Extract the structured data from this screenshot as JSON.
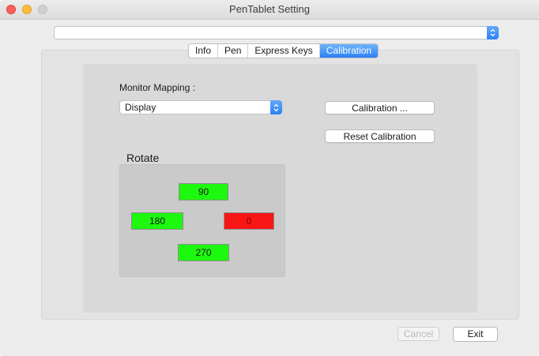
{
  "window": {
    "title": "PenTablet Setting"
  },
  "device_select": {
    "value": ""
  },
  "tabs": [
    {
      "label": "Info",
      "active": false
    },
    {
      "label": "Pen",
      "active": false
    },
    {
      "label": "Express Keys",
      "active": false
    },
    {
      "label": "Calibration",
      "active": true
    }
  ],
  "calibration": {
    "monitor_mapping_label": "Monitor Mapping :",
    "display_select": {
      "value": "Display"
    },
    "calibration_button": "Calibration ...",
    "reset_button": "Reset Calibration",
    "rotate_label": "Rotate",
    "rotate": {
      "r90": "90",
      "r180": "180",
      "r0": "0",
      "r270": "270",
      "selected": "0"
    }
  },
  "footer": {
    "cancel_label": "Cancel",
    "exit_label": "Exit"
  },
  "colors": {
    "accent": "#2d80f4",
    "rotate_inactive": "#1df80f",
    "rotate_selected": "#f71717"
  },
  "icons": {
    "popup": "updown-chevron-icon"
  }
}
